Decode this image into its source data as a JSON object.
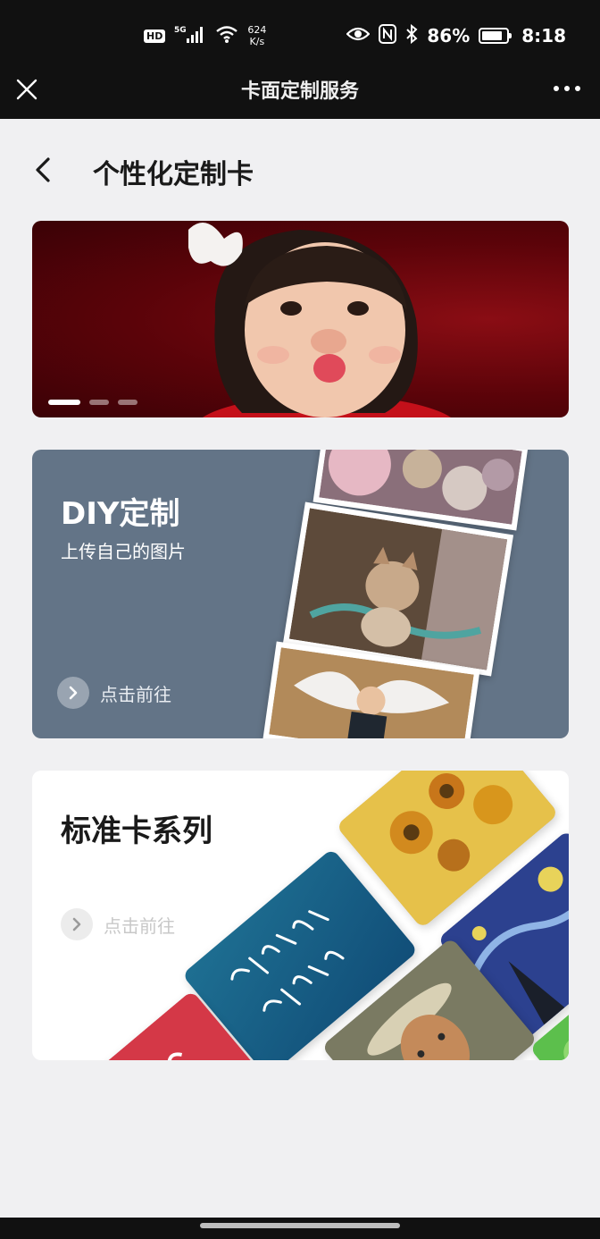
{
  "status_bar": {
    "hd": "HD",
    "signal": "5G",
    "net_speed_value": "624",
    "net_speed_unit": "K/s",
    "battery": "86%",
    "battery_level": 0.86,
    "time": "8:18"
  },
  "title_bar": {
    "title": "卡面定制服务"
  },
  "page": {
    "title": "个性化定制卡"
  },
  "banner": {
    "slide_count": 3,
    "active_index": 0
  },
  "diy_card": {
    "title": "DIY定制",
    "subtitle": "上传自己的图片",
    "go_label": "点击前往"
  },
  "standard_card": {
    "title": "标准卡系列",
    "go_label": "点击前往"
  },
  "colors": {
    "bar_bg": "#111111",
    "page_bg": "#f0f0f2",
    "diy_bg": "#637487",
    "banner_bg": "#5b0309"
  }
}
